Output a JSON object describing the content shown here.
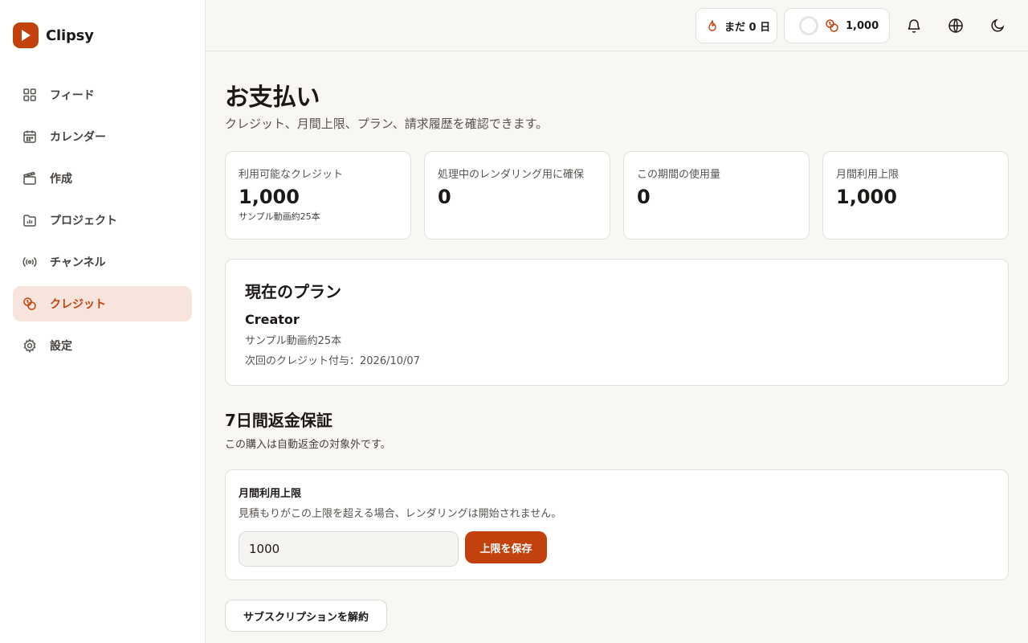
{
  "brand": {
    "name": "Clipsy",
    "logo_icon": "play-icon",
    "color": "#c2410c"
  },
  "sidebar": {
    "items": [
      {
        "label": "フィード",
        "icon": "grid-icon",
        "active": false
      },
      {
        "label": "カレンダー",
        "icon": "calendar-icon",
        "active": false
      },
      {
        "label": "作成",
        "icon": "clapperboard-icon",
        "active": false
      },
      {
        "label": "プロジェクト",
        "icon": "folder-chart-icon",
        "active": false
      },
      {
        "label": "チャンネル",
        "icon": "broadcast-icon",
        "active": false
      },
      {
        "label": "クレジット",
        "icon": "coins-icon",
        "active": true
      },
      {
        "label": "設定",
        "icon": "gear-icon",
        "active": false
      }
    ]
  },
  "topbar": {
    "streak_label": "まだ 0 日",
    "credits_label": "1,000",
    "icons": [
      "bell-icon",
      "globe-icon",
      "moon-icon"
    ]
  },
  "page": {
    "title": "お支払い",
    "subtitle": "クレジット、月間上限、プラン、請求履歴を確認できます。"
  },
  "stats": [
    {
      "label": "利用可能なクレジット",
      "value": "1,000",
      "note": "サンプル動画約25本"
    },
    {
      "label": "処理中のレンダリング用に確保",
      "value": "0",
      "note": ""
    },
    {
      "label": "この期間の使用量",
      "value": "0",
      "note": ""
    },
    {
      "label": "月間利用上限",
      "value": "1,000",
      "note": ""
    }
  ],
  "plan": {
    "heading": "現在のプラン",
    "name": "Creator",
    "line1": "サンプル動画約25本",
    "line2": "次回のクレジット付与：2026/10/07"
  },
  "refund": {
    "title": "7日間返金保証",
    "text": "この購入は自動返金の対象外です。"
  },
  "limit": {
    "title": "月間利用上限",
    "description": "見積もりがこの上限を超える場合、レンダリングは開始されません。",
    "value": "1000",
    "save_label": "上限を保存"
  },
  "cancel_label": "サブスクリプションを解約",
  "colors": {
    "accent": "#c2410c",
    "active_bg": "#f7e4dc",
    "background": "#f8f7f4"
  }
}
